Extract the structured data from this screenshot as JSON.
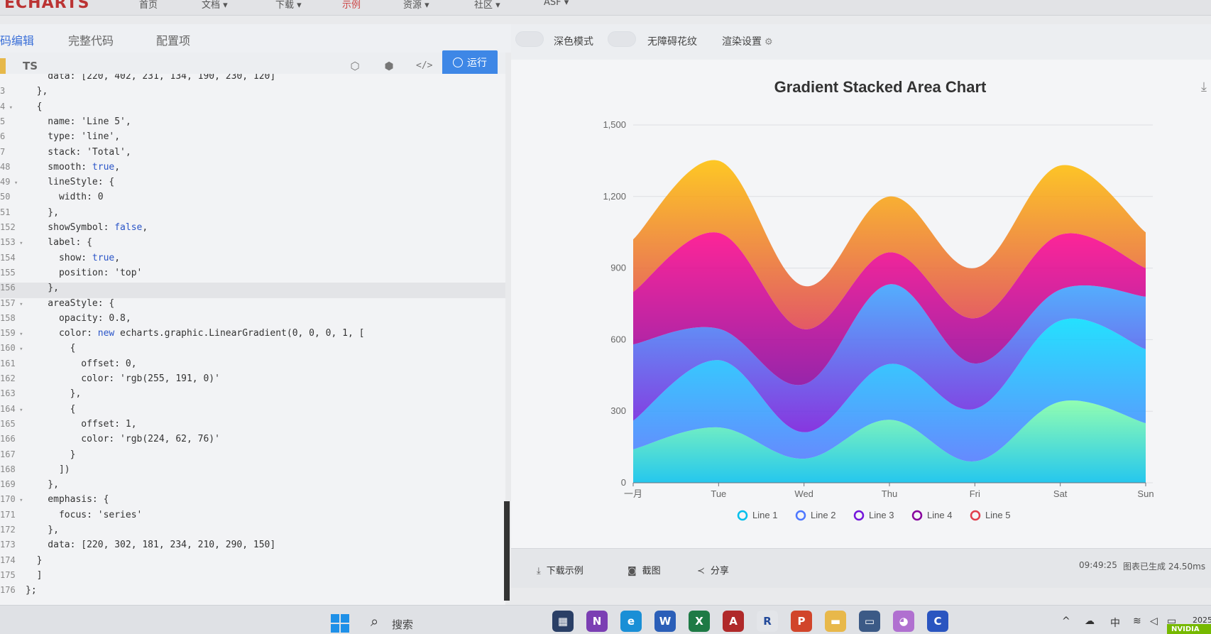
{
  "site": {
    "logo": "ECHARTS",
    "nav": [
      "首页",
      "文档 ▾",
      "下载 ▾",
      "示例",
      "资源 ▾",
      "社区 ▾",
      "ASF ▾"
    ]
  },
  "editor": {
    "tabs": [
      "码编辑",
      "完整代码",
      "配置项"
    ],
    "lang": "TS",
    "run_label": "运行",
    "code_lines": [
      {
        "n": "",
        "fold": "",
        "t": "    data: [220, 402, 231, 134, 190, 230, 120]",
        "hl": false
      },
      {
        "n": "3",
        "fold": "",
        "t": "  },",
        "hl": false
      },
      {
        "n": "4",
        "fold": "▾",
        "t": "  {",
        "hl": false
      },
      {
        "n": "5",
        "fold": "",
        "t": "    name: 'Line 5',",
        "hl": false
      },
      {
        "n": "6",
        "fold": "",
        "t": "    type: 'line',",
        "hl": false
      },
      {
        "n": "7",
        "fold": "",
        "t": "    stack: 'Total',",
        "hl": false
      },
      {
        "n": "48",
        "fold": "",
        "t": "    smooth: true,",
        "hl": false
      },
      {
        "n": "49",
        "fold": "▾",
        "t": "    lineStyle: {",
        "hl": false
      },
      {
        "n": "50",
        "fold": "",
        "t": "      width: 0",
        "hl": false
      },
      {
        "n": "51",
        "fold": "",
        "t": "    },",
        "hl": false
      },
      {
        "n": "152",
        "fold": "",
        "t": "    showSymbol: false,",
        "hl": false
      },
      {
        "n": "153",
        "fold": "▾",
        "t": "    label: {",
        "hl": false
      },
      {
        "n": "154",
        "fold": "",
        "t": "      show: true,",
        "hl": false
      },
      {
        "n": "155",
        "fold": "",
        "t": "      position: 'top'",
        "hl": false
      },
      {
        "n": "156",
        "fold": "",
        "t": "    },",
        "hl": true
      },
      {
        "n": "157",
        "fold": "▾",
        "t": "    areaStyle: {",
        "hl": false
      },
      {
        "n": "158",
        "fold": "",
        "t": "      opacity: 0.8,",
        "hl": false
      },
      {
        "n": "159",
        "fold": "▾",
        "t": "      color: new echarts.graphic.LinearGradient(0, 0, 0, 1, [",
        "hl": false
      },
      {
        "n": "160",
        "fold": "▾",
        "t": "        {",
        "hl": false
      },
      {
        "n": "161",
        "fold": "",
        "t": "          offset: 0,",
        "hl": false
      },
      {
        "n": "162",
        "fold": "",
        "t": "          color: 'rgb(255, 191, 0)'",
        "hl": false
      },
      {
        "n": "163",
        "fold": "",
        "t": "        },",
        "hl": false
      },
      {
        "n": "164",
        "fold": "▾",
        "t": "        {",
        "hl": false
      },
      {
        "n": "165",
        "fold": "",
        "t": "          offset: 1,",
        "hl": false
      },
      {
        "n": "166",
        "fold": "",
        "t": "          color: 'rgb(224, 62, 76)'",
        "hl": false
      },
      {
        "n": "167",
        "fold": "",
        "t": "        }",
        "hl": false
      },
      {
        "n": "168",
        "fold": "",
        "t": "      ])",
        "hl": false
      },
      {
        "n": "169",
        "fold": "",
        "t": "    },",
        "hl": false
      },
      {
        "n": "170",
        "fold": "▾",
        "t": "    emphasis: {",
        "hl": false
      },
      {
        "n": "171",
        "fold": "",
        "t": "      focus: 'series'",
        "hl": false
      },
      {
        "n": "172",
        "fold": "",
        "t": "    },",
        "hl": false
      },
      {
        "n": "173",
        "fold": "",
        "t": "    data: [220, 302, 181, 234, 210, 290, 150]",
        "hl": false
      },
      {
        "n": "174",
        "fold": "",
        "t": "  }",
        "hl": false
      },
      {
        "n": "175",
        "fold": "",
        "t": "  ]",
        "hl": false
      },
      {
        "n": "176",
        "fold": "",
        "t": "};",
        "hl": false
      }
    ]
  },
  "preview_toolbar": {
    "dark_mode": "深色模式",
    "a11y_pattern": "无障碍花纹",
    "render_settings": "渲染设置"
  },
  "chart_data": {
    "type": "area",
    "title": "Gradient Stacked Area Chart",
    "categories": [
      "一月",
      "Tue",
      "Wed",
      "Thu",
      "Fri",
      "Sat",
      "Sun"
    ],
    "ylim": [
      0,
      1500
    ],
    "yticks": [
      "0",
      "300",
      "600",
      "900",
      "1,200",
      "1,500"
    ],
    "stacked": true,
    "smooth": true,
    "legend_position": "bottom",
    "series": [
      {
        "name": "Line 1",
        "values": [
          140,
          232,
          101,
          264,
          90,
          340,
          250
        ],
        "color_top": "#80FFA5",
        "color_bottom": "#01BFEC"
      },
      {
        "name": "Line 2",
        "values": [
          120,
          282,
          111,
          234,
          220,
          340,
          310
        ],
        "color_top": "#00DDFF",
        "color_bottom": "#4D77FF"
      },
      {
        "name": "Line 3",
        "values": [
          320,
          132,
          201,
          334,
          190,
          130,
          220
        ],
        "color_top": "#37A2FF",
        "color_bottom": "#7415DB"
      },
      {
        "name": "Line 4",
        "values": [
          220,
          402,
          231,
          134,
          190,
          230,
          120
        ],
        "color_top": "#FF0087",
        "color_bottom": "#87009D"
      },
      {
        "name": "Line 5",
        "values": [
          220,
          302,
          181,
          234,
          210,
          290,
          150
        ],
        "color_top": "#FFBF00",
        "color_bottom": "#E03E4C"
      }
    ]
  },
  "status_bar": {
    "download": "下载示例",
    "screenshot": "截图",
    "share": "分享",
    "time": "09:49:25",
    "render_info": "图表已生成 24.50ms"
  },
  "taskbar": {
    "search": "搜索",
    "apps": [
      {
        "label": "▦",
        "color": "#2a3f66"
      },
      {
        "label": "N",
        "color": "#7b3fb3"
      },
      {
        "label": "e",
        "color": "#1a8fd6"
      },
      {
        "label": "W",
        "color": "#2b5fb8"
      },
      {
        "label": "X",
        "color": "#1e7a45"
      },
      {
        "label": "A",
        "color": "#b02a2a"
      },
      {
        "label": "R",
        "color": "#e3e5e9"
      },
      {
        "label": "P",
        "color": "#d1452b"
      },
      {
        "label": "▬",
        "color": "#e8b84a"
      },
      {
        "label": "▭",
        "color": "#3c5a86"
      },
      {
        "label": "◕",
        "color": "#b070d0"
      },
      {
        "label": "C",
        "color": "#2a55c0"
      }
    ],
    "ime": "中",
    "clock": "2025",
    "badge": "NVIDIA"
  }
}
